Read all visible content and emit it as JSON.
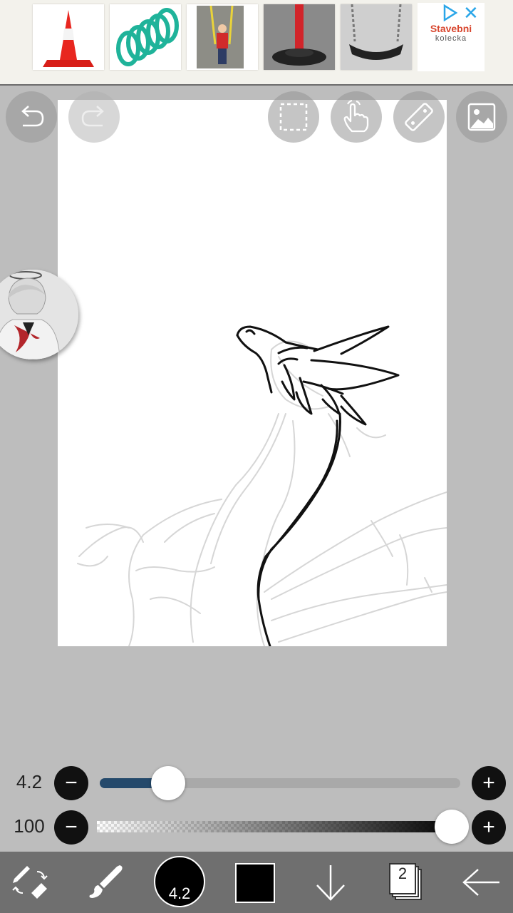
{
  "ad": {
    "brand_name": "Stavebni",
    "brand_sub": "kolecka",
    "close_label": "✕",
    "products": [
      "traffic-cone",
      "spiral-hose",
      "baby-swing",
      "post-base",
      "swing-seat"
    ]
  },
  "toolbar": {
    "undo_icon": "undo-icon",
    "redo_icon": "redo-icon",
    "select_icon": "selection-icon",
    "hand_icon": "hand-tool-icon",
    "ruler_icon": "ruler-icon",
    "material_icon": "image-icon"
  },
  "brush_size": {
    "value": "4.2",
    "fraction": 0.19,
    "minus": "−",
    "plus": "+"
  },
  "opacity": {
    "value": "100",
    "fraction": 1.0,
    "minus": "−",
    "plus": "+"
  },
  "bottom_bar": {
    "brush_size_label": "4.2",
    "color": "#000000",
    "layer_count": "2"
  },
  "colors": {
    "slider_fill": "#24496b",
    "bottom_bar_bg": "#6f6f6f",
    "background": "#bdbdbd"
  }
}
